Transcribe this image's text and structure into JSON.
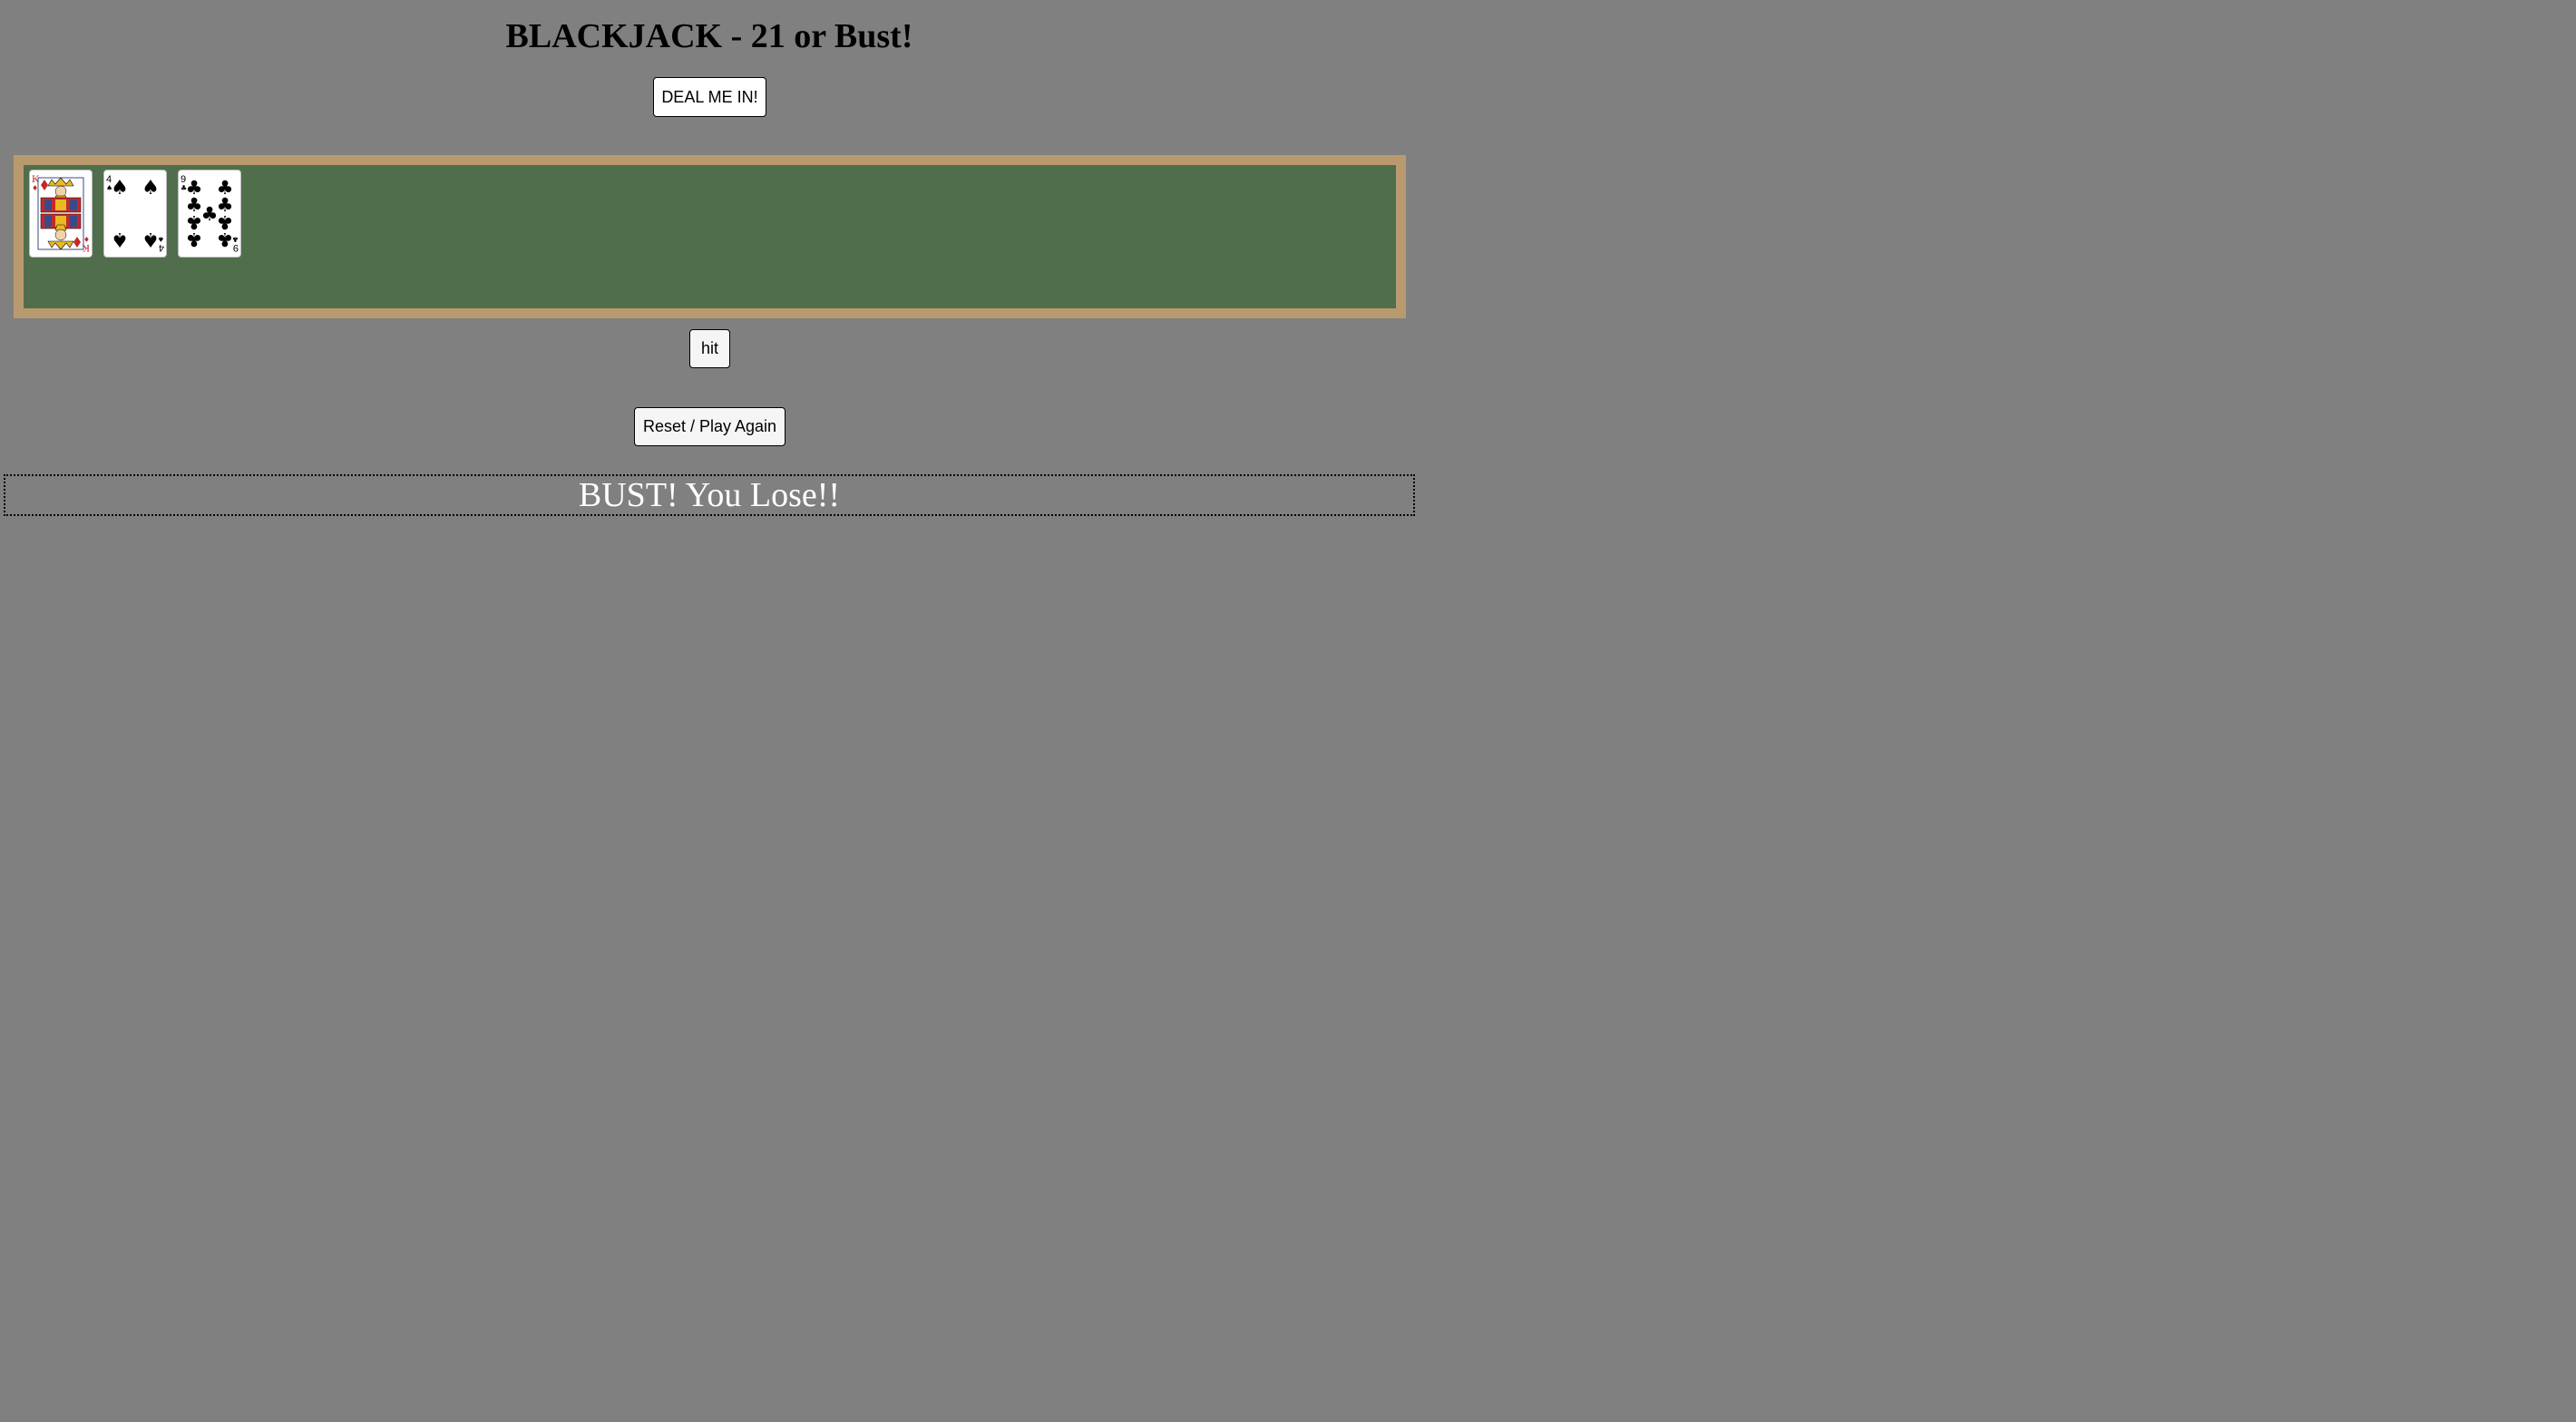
{
  "page": {
    "title": "BLACKJACK - 21 or Bust!"
  },
  "controls": {
    "deal_label": "DEAL ME IN!",
    "hit_label": "hit",
    "reset_label": "Reset / Play Again"
  },
  "hand": {
    "cards": [
      {
        "rank": "K",
        "suit": "diamonds",
        "suit_symbol": "♦",
        "color": "#c62828"
      },
      {
        "rank": "4",
        "suit": "spades",
        "suit_symbol": "♠",
        "color": "#000000"
      },
      {
        "rank": "9",
        "suit": "clubs",
        "suit_symbol": "♣",
        "color": "#000000"
      }
    ]
  },
  "result": {
    "message": "BUST! You Lose!!"
  },
  "colors": {
    "background": "#808080",
    "felt": "#506e4c",
    "rail": "#b99a6e",
    "red_suit": "#c62828"
  }
}
